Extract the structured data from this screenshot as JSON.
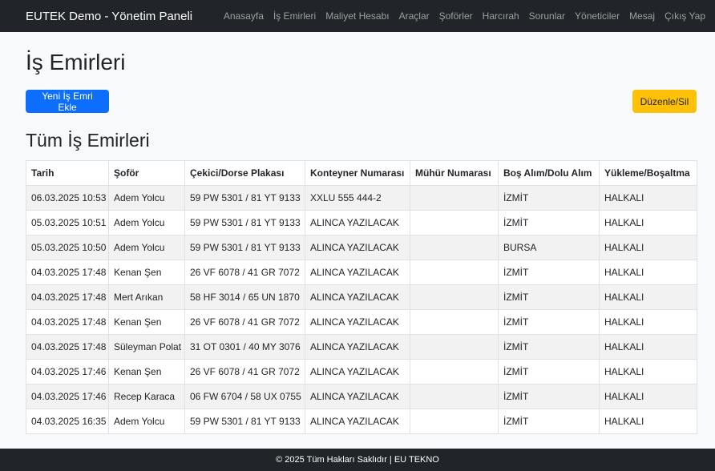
{
  "navbar": {
    "brand": "EUTEK Demo - Yönetim Paneli",
    "links": [
      "Anasayfa",
      "İş Emirleri",
      "Maliyet Hesabı",
      "Araçlar",
      "Şoförler",
      "Harcırah",
      "Sorunlar",
      "Yöneticiler",
      "Mesaj",
      "Çıkış Yap"
    ]
  },
  "page": {
    "title": "İş Emirleri",
    "add_button": "Yeni İş Emri Ekle",
    "edit_button": "Düzenle/Sil",
    "section_title": "Tüm İş Emirleri"
  },
  "table": {
    "headers": [
      "Tarih",
      "Şoför",
      "Çekici/Dorse Plakası",
      "Konteyner Numarası",
      "Mühür Numarası",
      "Boş Alım/Dolu Alım",
      "Yükleme/Boşaltma"
    ],
    "rows": [
      [
        "06.03.2025 10:53",
        "Adem Yolcu",
        "59 PW 5301 / 81 YT 9133",
        "XXLU 555 444-2",
        "",
        "İZMİT",
        "HALKALI"
      ],
      [
        "05.03.2025 10:51",
        "Adem Yolcu",
        "59 PW 5301 / 81 YT 9133",
        "ALINCA YAZILACAK",
        "",
        "İZMİT",
        "HALKALI"
      ],
      [
        "05.03.2025 10:50",
        "Adem Yolcu",
        "59 PW 5301 / 81 YT 9133",
        "ALINCA YAZILACAK",
        "",
        "BURSA",
        "HALKALI"
      ],
      [
        "04.03.2025 17:48",
        "Kenan Şen",
        "26 VF 6078 / 41 GR 7072",
        "ALINCA YAZILACAK",
        "",
        "İZMİT",
        "HALKALI"
      ],
      [
        "04.03.2025 17:48",
        "Mert Arıkan",
        "58 HF 3014 / 65 UN 1870",
        "ALINCA YAZILACAK",
        "",
        "İZMİT",
        "HALKALI"
      ],
      [
        "04.03.2025 17:48",
        "Kenan Şen",
        "26 VF 6078 / 41 GR 7072",
        "ALINCA YAZILACAK",
        "",
        "İZMİT",
        "HALKALI"
      ],
      [
        "04.03.2025 17:48",
        "Süleyman Polat",
        "31 OT 0301 / 40 MY 3076",
        "ALINCA YAZILACAK",
        "",
        "İZMİT",
        "HALKALI"
      ],
      [
        "04.03.2025 17:46",
        "Kenan Şen",
        "26 VF 6078 / 41 GR 7072",
        "ALINCA YAZILACAK",
        "",
        "İZMİT",
        "HALKALI"
      ],
      [
        "04.03.2025 17:46",
        "Recep Karaca",
        "06 FW 6704 / 58 UX 0755",
        "ALINCA YAZILACAK",
        "",
        "İZMİT",
        "HALKALI"
      ],
      [
        "04.03.2025 16:35",
        "Adem Yolcu",
        "59 PW 5301 / 81 YT 9133",
        "ALINCA YAZILACAK",
        "",
        "İZMİT",
        "HALKALI"
      ]
    ]
  },
  "footer": {
    "text": "© 2025 Tüm Hakları Saklıdır | EU TEKNO"
  },
  "colors": {
    "navbar_bg": "#212529",
    "primary": "#0d6efd",
    "warning": "#ffc107",
    "striped_row": "#f2f2f2"
  }
}
